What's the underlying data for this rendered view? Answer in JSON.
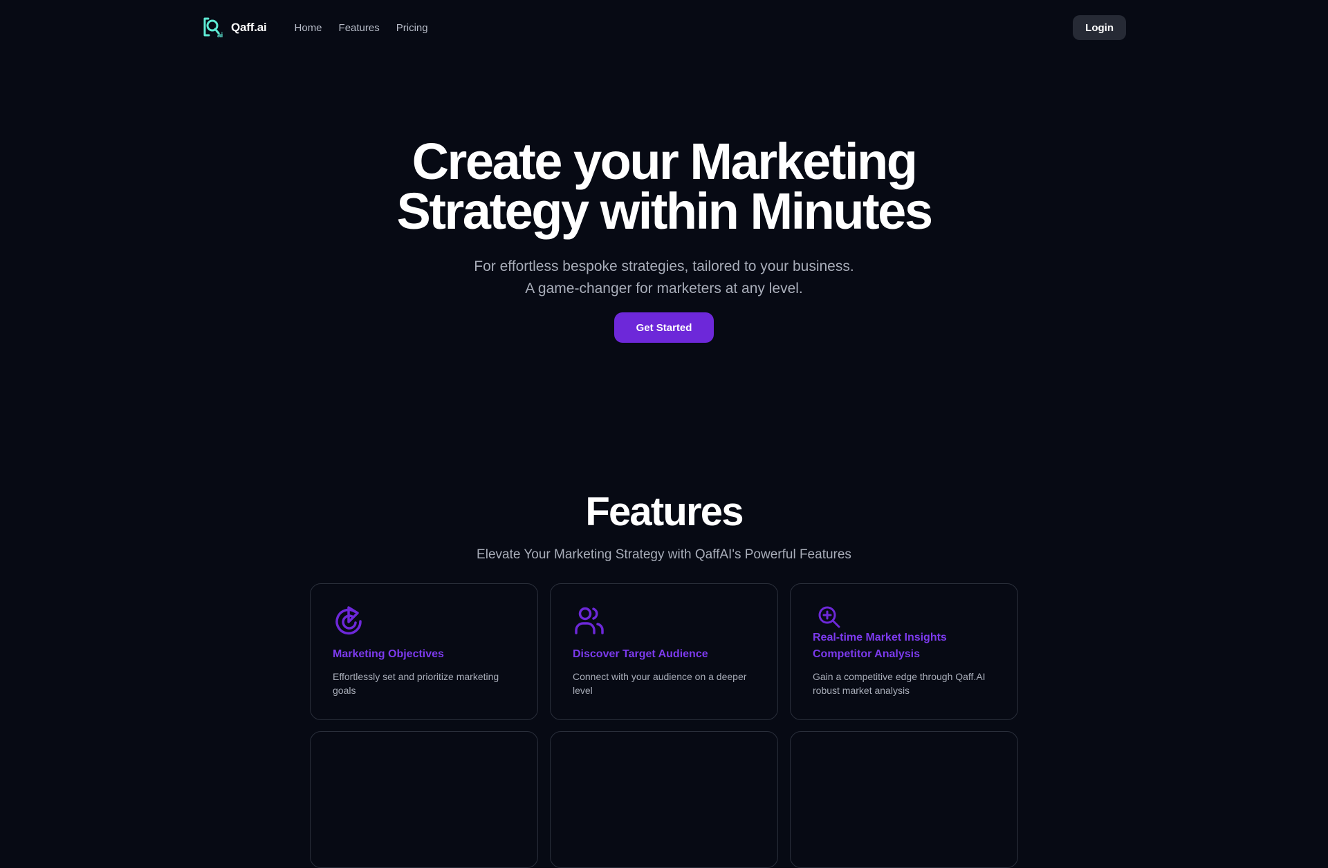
{
  "nav": {
    "brand": "Qaff.ai",
    "logo_icon": "qaff-logo-icon",
    "links": [
      "Home",
      "Features",
      "Pricing"
    ],
    "login_label": "Login"
  },
  "hero": {
    "title_line1": "Create your Marketing",
    "title_line2": "Strategy within Minutes",
    "subtitle_line1": "For effortless bespoke strategies, tailored to your business.",
    "subtitle_line2": "A game-changer for marketers at any level.",
    "cta_label": "Get Started"
  },
  "features": {
    "title": "Features",
    "subtitle": "Elevate Your Marketing Strategy with QaffAI's Powerful Features",
    "cards": [
      {
        "icon": "target-arrow-icon",
        "title": "Marketing Objectives",
        "desc": "Effortlessly set and prioritize marketing goals"
      },
      {
        "icon": "users-icon",
        "title": "Discover Target Audience",
        "desc": "Connect with your audience on a deeper level"
      },
      {
        "icon": "zoom-in-icon",
        "title": "Real-time Market Insights Competitor Analysis",
        "desc": "Gain a competitive edge through Qaff.AI robust market analysis"
      }
    ]
  },
  "colors": {
    "background": "#070a14",
    "accent": "#6d28d9",
    "card_title": "#7c3aed",
    "logo": "#5eead4",
    "muted_text": "#a8adb9"
  }
}
